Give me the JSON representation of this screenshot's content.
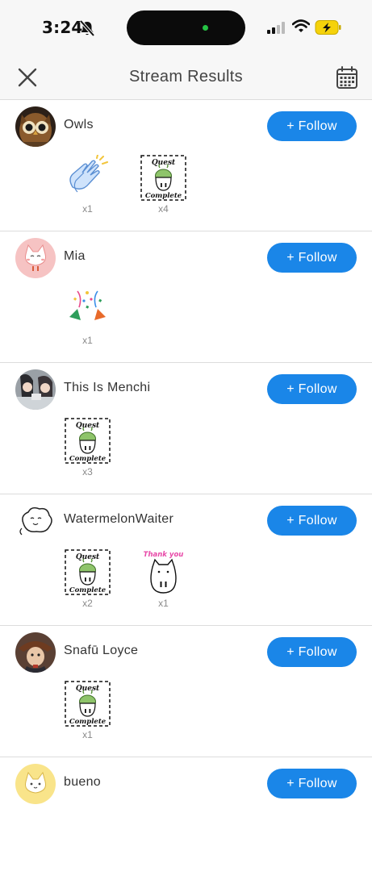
{
  "status_bar": {
    "time": "3:24"
  },
  "header": {
    "title": "Stream Results"
  },
  "follow_label": "+ Follow",
  "stream_results": [
    {
      "name": "Owls",
      "avatar": "owl-avatar",
      "gifts": [
        {
          "sticker": "clapping-hands-sticker",
          "count": "x1"
        },
        {
          "sticker": "quest-complete-sticker",
          "count": "x4"
        }
      ]
    },
    {
      "name": "Mia",
      "avatar": "pink-cat-avatar",
      "gifts": [
        {
          "sticker": "party-popper-sticker",
          "count": "x1"
        }
      ]
    },
    {
      "name": "This Is Menchi",
      "avatar": "anime-characters-avatar",
      "gifts": [
        {
          "sticker": "quest-complete-sticker",
          "count": "x3"
        }
      ]
    },
    {
      "name": "WatermelonWaiter",
      "avatar": "cloud-creature-avatar",
      "gifts": [
        {
          "sticker": "quest-complete-sticker",
          "count": "x2"
        },
        {
          "sticker": "thank-you-sticker",
          "count": "x1",
          "caption": "Thank you"
        }
      ]
    },
    {
      "name": "Snafū Loyce",
      "avatar": "painted-portrait-avatar",
      "gifts": [
        {
          "sticker": "quest-complete-sticker",
          "count": "x1"
        }
      ]
    },
    {
      "name": "bueno",
      "avatar": "yellow-cat-avatar",
      "gifts": []
    }
  ],
  "sticker_text": {
    "quest": "Quest",
    "complete": "Complete"
  },
  "colors": {
    "follow_button": "#1a86e8",
    "background": "#ffffff",
    "header_background": "#f7f7f7",
    "battery": "#f5d20b"
  }
}
